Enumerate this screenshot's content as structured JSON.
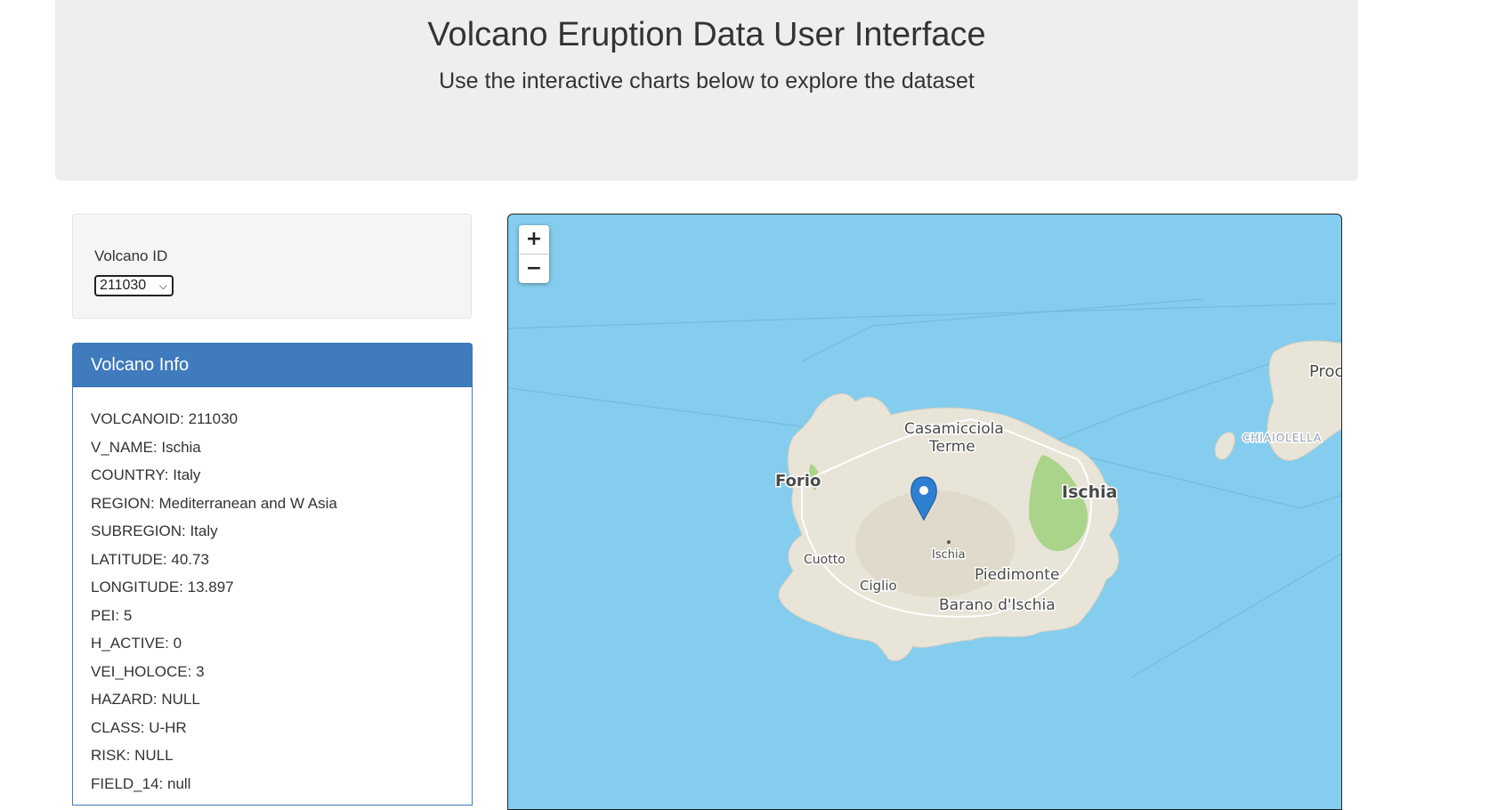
{
  "header": {
    "title": "Volcano Eruption Data User Interface",
    "subtitle": "Use the interactive charts below to explore the dataset"
  },
  "selector": {
    "label": "Volcano ID",
    "selected": "211030"
  },
  "info_panel": {
    "title": "Volcano Info",
    "lines": [
      "VOLCANOID: 211030",
      "V_NAME: Ischia",
      "COUNTRY: Italy",
      "REGION: Mediterranean and W Asia",
      "SUBREGION: Italy",
      "LATITUDE: 40.73",
      "LONGITUDE: 13.897",
      "PEI: 5",
      "H_ACTIVE: 0",
      "VEI_HOLOCE: 3",
      "HAZARD: NULL",
      "CLASS: U-HR",
      "RISK: NULL",
      "FIELD_14: null"
    ]
  },
  "map": {
    "zoom_in": "+",
    "zoom_out": "−",
    "water_color": "#84cdee",
    "land_color": "#e8e4d8",
    "park_color": "#a9d48a",
    "marker_color": "#2f7fd1",
    "labels": {
      "casamicciola_1": "Casamicciola",
      "casamicciola_2": "Terme",
      "forio": "Forio",
      "ischia_town": "Ischia",
      "ischia_peak": "Ischia",
      "cuotto": "Cuotto",
      "ciglio": "Ciglio",
      "piedimonte": "Piedimonte",
      "barano": "Barano d'Ischia",
      "procida": "Proc",
      "chiaiolella": "CHIAIOLELLA"
    }
  }
}
